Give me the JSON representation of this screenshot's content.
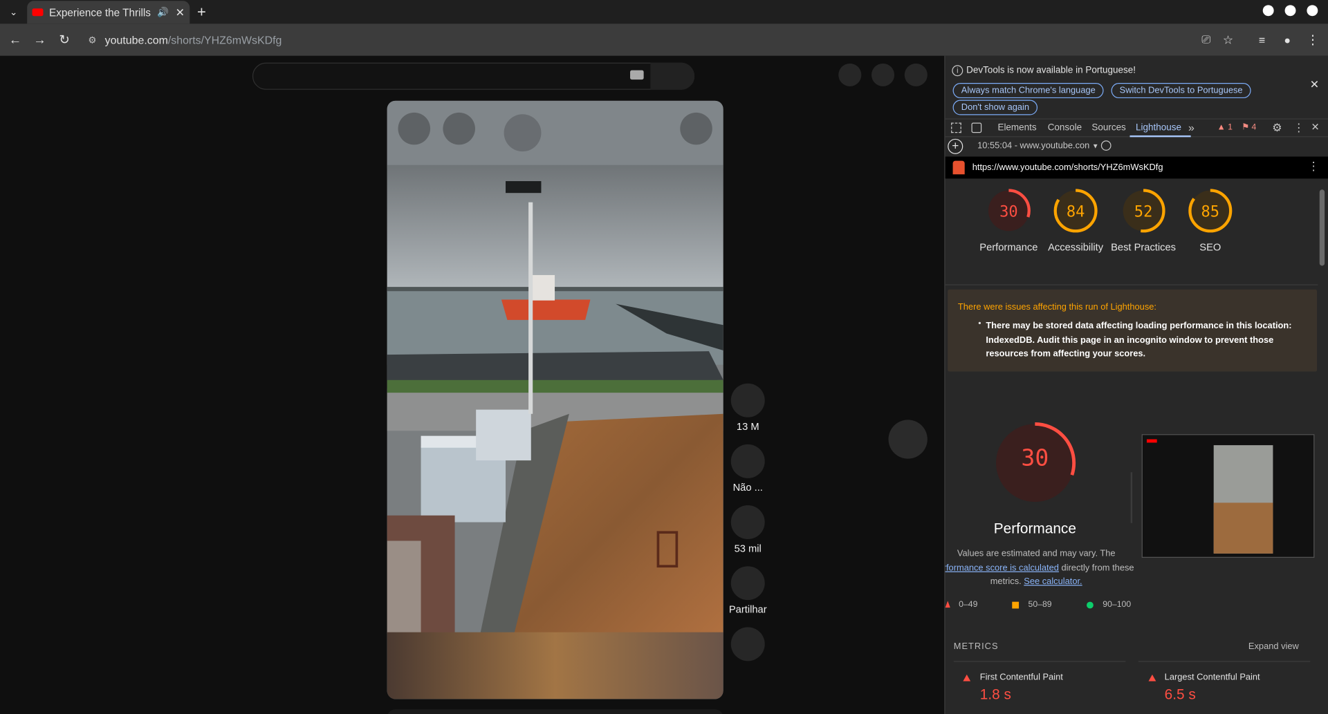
{
  "browser": {
    "tab_title": "Experience the Thrills",
    "url_host": "youtube.com",
    "url_path": "/shorts/YHZ6mWsKDfg"
  },
  "shorts": {
    "likes": "13 M",
    "dislike": "Não ...",
    "comments": "53 mil",
    "share": "Partilhar"
  },
  "devtools": {
    "banner_text": "DevTools is now available in Portuguese!",
    "banner_buttons": [
      "Always match Chrome's language",
      "Switch DevTools to Portuguese",
      "Don't show again"
    ],
    "tabs": [
      "Elements",
      "Console",
      "Sources",
      "Lighthouse"
    ],
    "active_tab": "Lighthouse",
    "warnings_count": "1",
    "issues_count": "4",
    "report_time": "10:55:04 - www.youtube.con",
    "report_url": "https://www.youtube.com/shorts/YHZ6mWsKDfg",
    "scores": [
      {
        "label": "Performance",
        "value": "30",
        "color": "#ff4e42"
      },
      {
        "label": "Accessibility",
        "value": "84",
        "color": "#ffa400"
      },
      {
        "label": "Best Practices",
        "value": "52",
        "color": "#ffa400"
      },
      {
        "label": "SEO",
        "value": "85",
        "color": "#ffa400"
      }
    ],
    "warning_title": "There were issues affecting this run of Lighthouse:",
    "warning_item": "There may be stored data affecting loading performance in this location: IndexedDB. Audit this page in an incognito window to prevent those resources from affecting your scores.",
    "perf_score": "30",
    "perf_title": "Performance",
    "perf_desc_1": "Values are estimated and may vary. The",
    "perf_desc_link": "performance score is calculated",
    "perf_desc_2": "directly from these",
    "perf_desc_3": "metrics.",
    "perf_desc_link2": "See calculator.",
    "legend": [
      "0–49",
      "50–89",
      "90–100"
    ],
    "metrics_title": "METRICS",
    "expand_view": "Expand view",
    "metrics": [
      {
        "label": "First Contentful Paint",
        "value": "1.8 s"
      },
      {
        "label": "Largest Contentful Paint",
        "value": "6.5 s"
      }
    ]
  }
}
